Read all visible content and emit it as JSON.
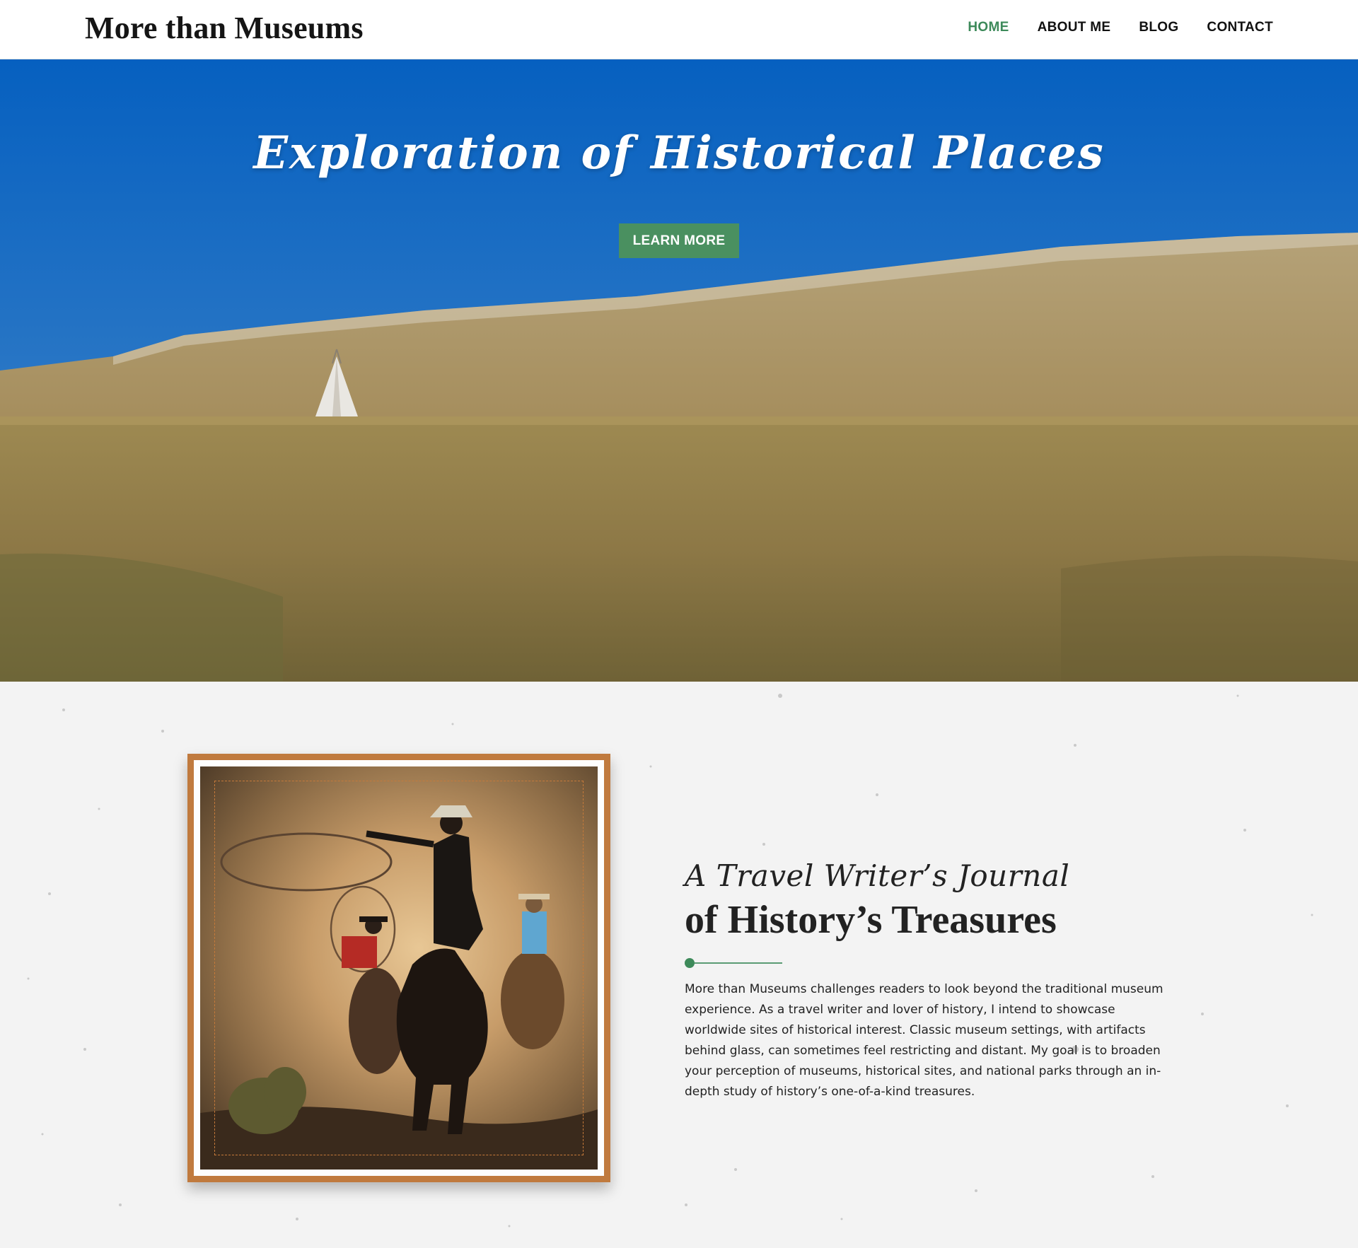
{
  "header": {
    "brand": "More than Museums",
    "nav": [
      {
        "label": "HOME",
        "active": true
      },
      {
        "label": "ABOUT ME",
        "active": false
      },
      {
        "label": "BLOG",
        "active": false
      },
      {
        "label": "CONTACT",
        "active": false
      }
    ]
  },
  "hero": {
    "title": "Exploration of Historical Places",
    "button_label": "LEARN MORE",
    "image": "prairie-landscape-with-tipi"
  },
  "about": {
    "image": "cowboys-roping-on-horseback",
    "kicker": "A Travel Writer’s Journal",
    "heading": "of History’s Treasures",
    "body": "More than Museums challenges readers to look beyond the traditional museum experience. As a travel writer and lover of history, I intend to showcase worldwide sites of historical interest. Classic museum settings, with artifacts behind glass, can sometimes feel restricting and distant. My goal is to broaden your perception of museums, historical sites, and national parks through an in-depth study of history’s one-of-a-kind treasures."
  },
  "colors": {
    "accent_green": "#3d8a5a",
    "button_green": "#4a9060",
    "frame_orange": "#c07a3e",
    "sky_blue": "#0a61be"
  }
}
